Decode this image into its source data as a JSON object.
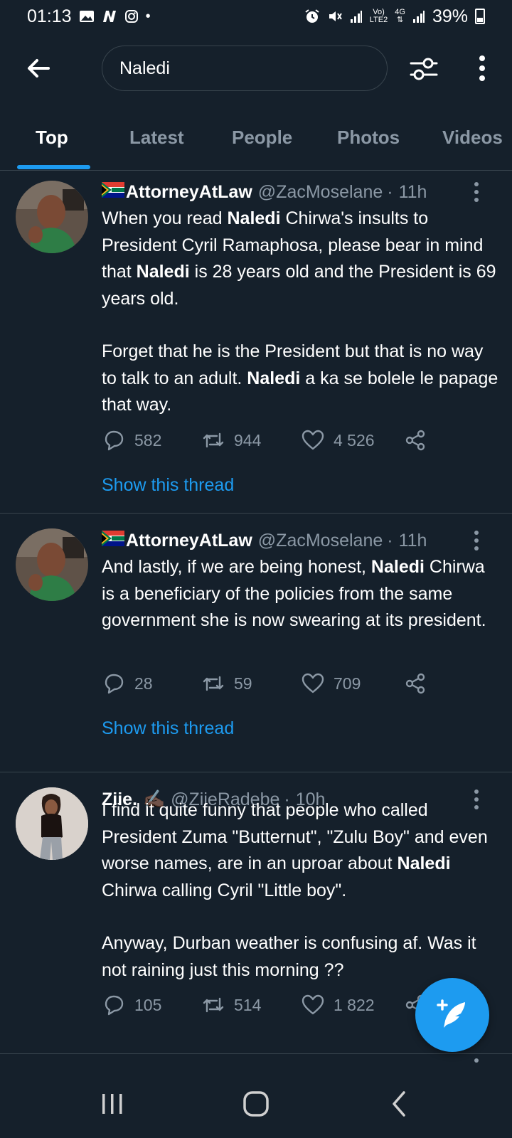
{
  "status_bar": {
    "time": "01:13",
    "network_label_top": "Vo)",
    "network_label_bottom": "LTE2",
    "signal_label_top": "4G",
    "battery": "39%",
    "icons": [
      "gallery-icon",
      "n-app-icon",
      "instagram-icon",
      "dot-icon",
      "alarm-icon",
      "mute-icon",
      "signal-icon",
      "battery-icon"
    ]
  },
  "search": {
    "query": "Naledi"
  },
  "tabs": [
    {
      "label": "Top",
      "active": true
    },
    {
      "label": "Latest",
      "active": false
    },
    {
      "label": "People",
      "active": false
    },
    {
      "label": "Photos",
      "active": false
    },
    {
      "label": "Videos",
      "active": false
    }
  ],
  "tweets": [
    {
      "name": "AttorneyAtLaw",
      "handle": "@ZacMoselane",
      "time": "11h",
      "para1": [
        {
          "t": "When you read ",
          "b": false
        },
        {
          "t": "Naledi",
          "b": true
        },
        {
          "t": " Chirwa's insults to President Cyril Ramaphosa, please bear in mind that ",
          "b": false
        },
        {
          "t": "Naledi",
          "b": true
        },
        {
          "t": " is 28 years old and the President is 69 years old.",
          "b": false
        }
      ],
      "para2": [
        {
          "t": "Forget that he is the President but that is no way to talk to an adult. ",
          "b": false
        },
        {
          "t": "Naledi",
          "b": true
        },
        {
          "t": " a ka se bolele le papage that way.",
          "b": false
        }
      ],
      "replies": "582",
      "retweets": "944",
      "likes": "4 526",
      "show_thread": "Show this thread"
    },
    {
      "name": "AttorneyAtLaw",
      "handle": "@ZacMoselane",
      "time": "11h",
      "para1": [
        {
          "t": "And lastly, if we are being honest, ",
          "b": false
        },
        {
          "t": "Naledi",
          "b": true
        },
        {
          "t": " Chirwa is a beneficiary of the policies from the same government she is now swearing at its president.",
          "b": false
        }
      ],
      "replies": "28",
      "retweets": "59",
      "likes": "709",
      "show_thread": "Show this thread"
    },
    {
      "name": "Ziie.",
      "name_emoji": "✍🏿",
      "handle": "@ZiieRadebe",
      "time": "10h",
      "para1": [
        {
          "t": "I find it quite funny that people who called President Zuma \"Butternut\", \"Zulu Boy\" and even worse names, are in an uproar about ",
          "b": false
        },
        {
          "t": "Naledi",
          "b": true
        },
        {
          "t": " Chirwa calling Cyril \"Little boy\".",
          "b": false
        }
      ],
      "para2": [
        {
          "t": "Anyway, Durban weather is confusing af. Was it not raining just this morning ??",
          "b": false
        }
      ],
      "replies": "105",
      "retweets": "514",
      "likes": "1 822"
    }
  ],
  "colors": {
    "background": "#15202b",
    "accent": "#1d9bf0",
    "secondary_text": "#8b98a5",
    "divider": "#38444d"
  }
}
